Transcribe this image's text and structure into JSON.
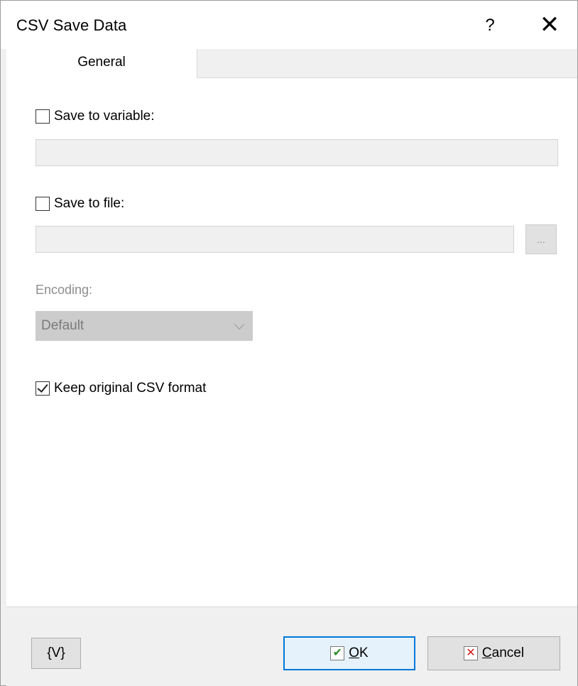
{
  "window": {
    "title": "CSV Save Data",
    "help_glyph": "?",
    "close_glyph": "✕"
  },
  "tabs": [
    {
      "label": "General",
      "active": true
    }
  ],
  "save_to_variable": {
    "label": "Save to variable:",
    "checked": false,
    "value": ""
  },
  "save_to_file": {
    "label": "Save to file:",
    "checked": false,
    "value": "",
    "browse_label": "..."
  },
  "encoding": {
    "label": "Encoding:",
    "selected": "Default",
    "enabled": false
  },
  "keep_format": {
    "label": "Keep original CSV format",
    "checked": true
  },
  "buttons": {
    "variables": "{V}",
    "ok": {
      "mnemonic": "O",
      "rest": "K",
      "icon": "✔"
    },
    "cancel": {
      "mnemonic": "C",
      "rest": "ancel",
      "icon": "✕"
    }
  },
  "colors": {
    "focus_border": "#0078d7",
    "ok_icon": "#2e8b2e",
    "cancel_icon": "#d01818"
  }
}
